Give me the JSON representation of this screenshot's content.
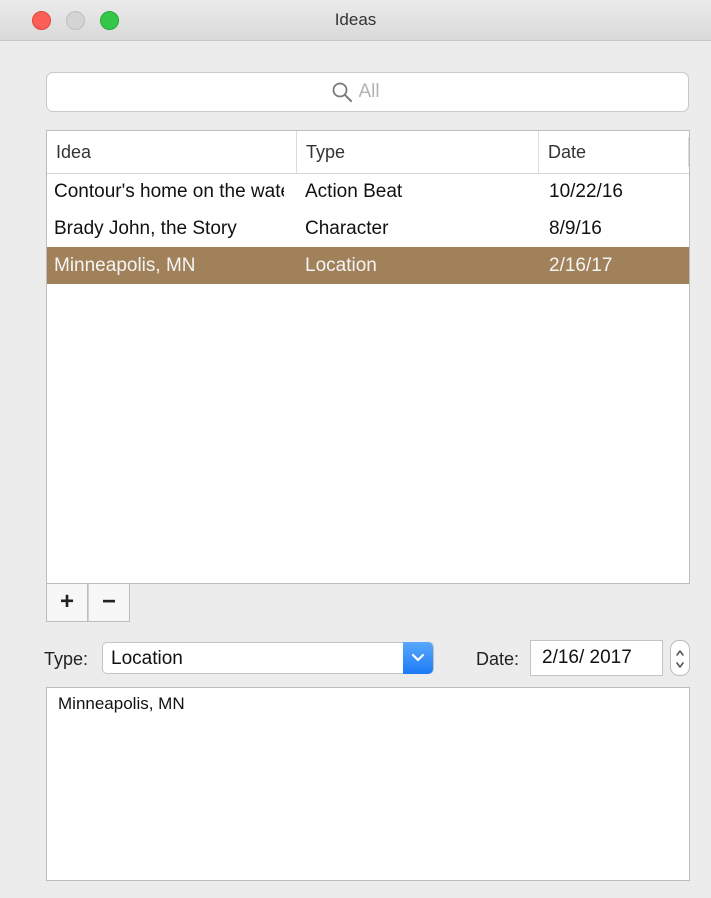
{
  "window": {
    "title": "Ideas"
  },
  "search": {
    "placeholder": "All",
    "icon": "search-icon"
  },
  "table": {
    "columns": [
      "Idea",
      "Type",
      "Date"
    ],
    "rows": [
      {
        "idea": "Contour's home on the water",
        "type": "Action Beat",
        "date": "10/22/16",
        "selected": false
      },
      {
        "idea": "Brady John, the Story",
        "type": "Character",
        "date": "8/9/16",
        "selected": false
      },
      {
        "idea": "Minneapolis, MN",
        "type": "Location",
        "date": "2/16/17",
        "selected": true
      }
    ],
    "selected_color": "#a18159"
  },
  "controls": {
    "add_label": "+",
    "remove_label": "−"
  },
  "detail": {
    "type_label": "Type:",
    "type_value": "Location",
    "date_label": "Date:",
    "date_value": "2/16/ 2017",
    "notes": "Minneapolis, MN"
  }
}
